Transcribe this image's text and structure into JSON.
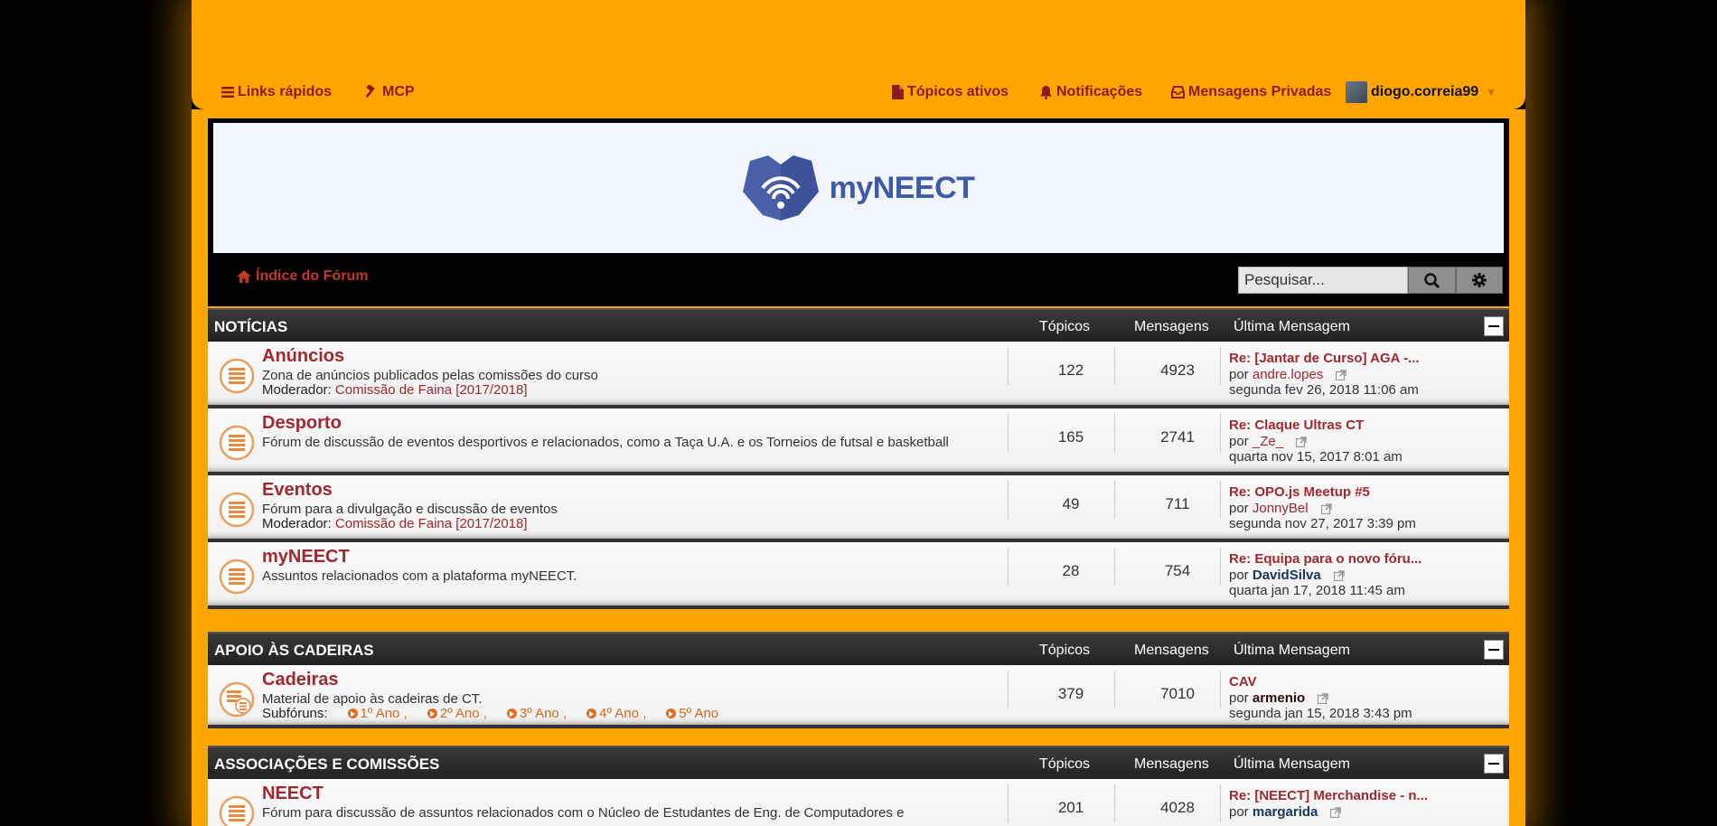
{
  "topnav": {
    "quick_links": "Links rápidos",
    "mcp": "MCP",
    "active_topics": "Tópicos ativos",
    "notifications": "Notificações",
    "private_messages": "Mensagens Privadas",
    "username": "diogo.correia99"
  },
  "header": {
    "logo_text": "myNEECT",
    "forum_index": "Índice do Fórum",
    "search_placeholder": "Pesquisar..."
  },
  "columns": {
    "topics": "Tópicos",
    "posts": "Mensagens",
    "last": "Última Mensagem"
  },
  "categories": [
    {
      "title": "NOTÍCIAS",
      "forums": [
        {
          "title": "Anúncios",
          "desc": "Zona de anúncios publicados pelas comissões do curso",
          "mod_label": "Moderador:",
          "mod": "Comissão de Faina [2017/2018]",
          "topics": "122",
          "posts": "4923",
          "last_title": "Re: [Jantar de Curso] AGA -...",
          "by": "por",
          "last_user": "andre.lopes",
          "last_date": "segunda fev 26, 2018 11:06 am"
        },
        {
          "title": "Desporto",
          "desc": "Fórum de discussão de eventos desportivos e relacionados, como a Taça U.A. e os Torneios de futsal e basketball",
          "topics": "165",
          "posts": "2741",
          "last_title": "Re: Claque Ultras CT",
          "by": "por",
          "last_user": "_Ze_",
          "last_date": "quarta nov 15, 2017 8:01 am"
        },
        {
          "title": "Eventos",
          "desc": "Fórum para a divulgação e discussão de eventos",
          "mod_label": "Moderador:",
          "mod": "Comissão de Faina [2017/2018]",
          "topics": "49",
          "posts": "711",
          "last_title": "Re: OPO.js Meetup #5",
          "by": "por",
          "last_user": "JonnyBel",
          "last_date": "segunda nov 27, 2017 3:39 pm"
        },
        {
          "title": "myNEECT",
          "desc": "Assuntos relacionados com a plataforma myNEECT.",
          "topics": "28",
          "posts": "754",
          "last_title": "Re: Equipa para o novo fóru...",
          "by": "por",
          "last_user": "DavidSilva",
          "last_date": "quarta jan 17, 2018 11:45 am"
        }
      ]
    },
    {
      "title": "APOIO ÀS CADEIRAS",
      "forums": [
        {
          "title": "Cadeiras",
          "desc": "Material de apoio às cadeiras de CT.",
          "sub_label": "Subfóruns:",
          "subforums": [
            "1º Ano ,",
            "2º Ano ,",
            "3º Ano ,",
            "4º Ano ,",
            "5º Ano"
          ],
          "topics": "379",
          "posts": "7010",
          "last_title": "CAV",
          "by": "por",
          "last_user": "armenio",
          "last_date": "segunda jan 15, 2018 3:43 pm"
        }
      ]
    },
    {
      "title": "ASSOCIAÇÕES E COMISSÕES",
      "forums": [
        {
          "title": "NEECT",
          "desc": "Fórum para discussão de assuntos relacionados com o Núcleo de Estudantes de Eng. de Computadores e",
          "topics": "201",
          "posts": "4028",
          "last_title": "Re: [NEECT] Merchandise - n...",
          "by": "por",
          "last_user": "margarida"
        }
      ]
    }
  ]
}
